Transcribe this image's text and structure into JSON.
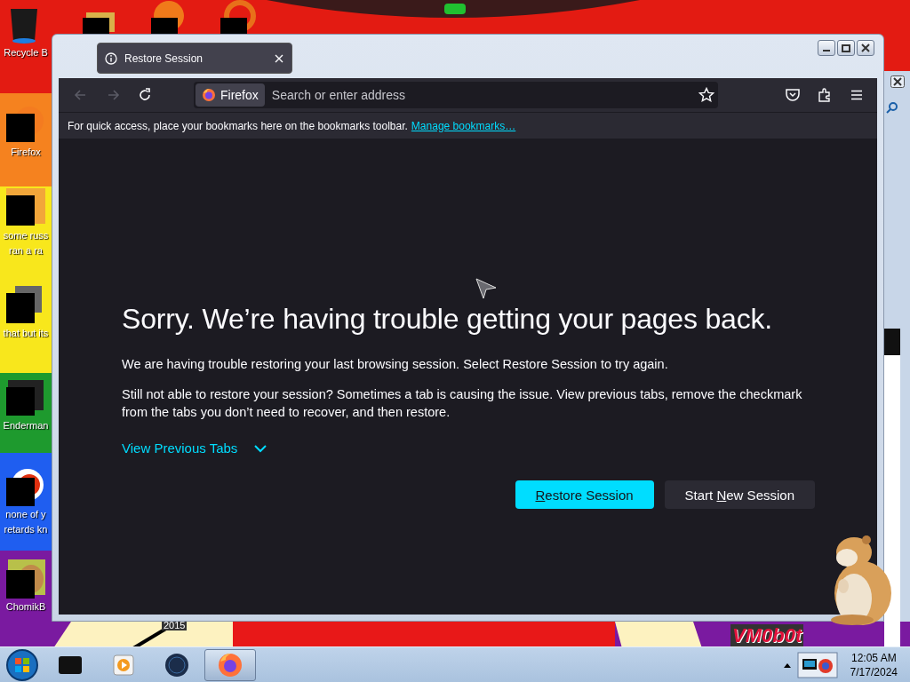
{
  "desktop": {
    "top_icons": [
      {
        "kind": "folder"
      },
      {
        "kind": "ball"
      },
      {
        "kind": "ring"
      }
    ],
    "icons": [
      {
        "kind": "bin",
        "lines": [
          "Recycle B"
        ]
      },
      {
        "kind": "fox",
        "lines": [
          "Firefox"
        ]
      },
      {
        "kind": "letter",
        "lines": [
          "some russ",
          "ran a ra"
        ]
      },
      {
        "kind": "stack",
        "lines": [
          "that but its"
        ]
      },
      {
        "kind": "console",
        "lines": [
          "Enderman"
        ]
      },
      {
        "kind": "ring",
        "lines": [
          "none of y",
          "retards kn"
        ]
      },
      {
        "kind": "hamster",
        "lines": [
          "ChomikB"
        ]
      }
    ],
    "wallpaper_texts": [
      "2015",
      "VM0b0t"
    ]
  },
  "window": {
    "tab": {
      "title": "Restore Session",
      "selected": true
    },
    "nav_buttons": [
      {
        "kind": "back",
        "disabled": true
      },
      {
        "kind": "forward",
        "disabled": true
      },
      {
        "kind": "reload",
        "disabled": false
      }
    ],
    "identity": "Firefox",
    "address": {
      "placeholder": "Search or enter address"
    },
    "bookmarks_bar": {
      "text": "For quick access, place your bookmarks here on the bookmarks toolbar.",
      "link": "Manage bookmarks…"
    },
    "page": {
      "heading": "Sorry. We’re having trouble getting your pages back.",
      "paragraphs": [
        "We are having trouble restoring your last browsing session. Select Restore Session to try again.",
        "Still not able to restore your session? Sometimes a tab is causing the issue. View previous tabs, remove the checkmark from the tabs you don’t need to recover, and then restore."
      ],
      "toggle": {
        "label": "View Previous Tabs",
        "expanded": false
      },
      "buttons": [
        {
          "kind": "primary",
          "key": "R",
          "after": "estore Session"
        },
        {
          "kind": "secondary",
          "before": "Start ",
          "key": "N",
          "after": "ew Session"
        }
      ]
    }
  },
  "taskbar": {
    "items": [
      {
        "kind": "console",
        "selected": false
      },
      {
        "kind": "media",
        "selected": false
      },
      {
        "kind": "globe",
        "selected": false
      },
      {
        "kind": "fox",
        "selected": true
      }
    ],
    "clock": {
      "time": "12:05 AM",
      "date": "7/17/2024"
    }
  }
}
